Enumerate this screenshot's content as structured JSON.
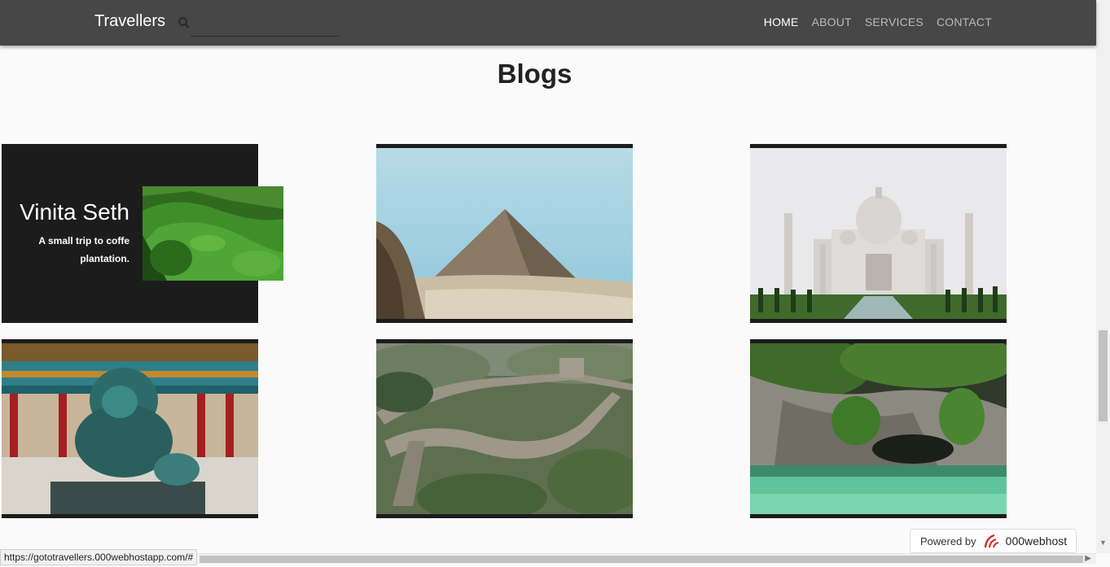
{
  "nav": {
    "brand": "Travellers",
    "search_placeholder": "",
    "links": [
      {
        "label": "HOME",
        "active": true
      },
      {
        "label": "ABOUT",
        "active": false
      },
      {
        "label": "SERVICES",
        "active": false
      },
      {
        "label": "CONTACT",
        "active": false
      }
    ]
  },
  "section": {
    "title": "Blogs"
  },
  "featured": {
    "name": "Vinita Seth",
    "desc": "A small trip to coffe plantation."
  },
  "status_url": "https://gototravellers.000webhostapp.com/#",
  "powered": {
    "label": "Powered by",
    "brand": "000webhost"
  }
}
